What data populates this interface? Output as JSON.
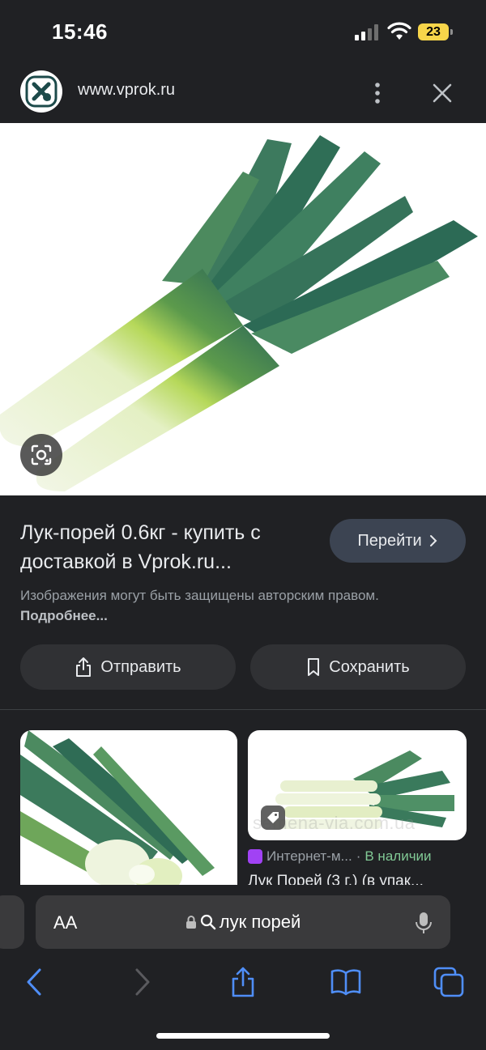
{
  "status_bar": {
    "time": "15:46",
    "battery": "23"
  },
  "site": {
    "url": "www.vprok.ru"
  },
  "result": {
    "title": "Лук-порей 0.6кг - купить с доставкой в Vprok.ru...",
    "visit_label": "Перейти",
    "copyright": "Изображения могут быть защищены авторским правом.",
    "more_link": "Подробнее..."
  },
  "actions": {
    "share_label": "Отправить",
    "save_label": "Сохранить"
  },
  "related": {
    "watermark": "semena-via.com.ua",
    "source": "Интернет-м...",
    "separator": "·",
    "stock": "В наличии",
    "caption": "Лук Порей (3 г.) (в упак..."
  },
  "address_bar": {
    "aa": "AA",
    "query": "лук порей"
  },
  "colors": {
    "accent": "#4f8ef7",
    "stock": "#81c995",
    "battery": "#f7d54a"
  }
}
